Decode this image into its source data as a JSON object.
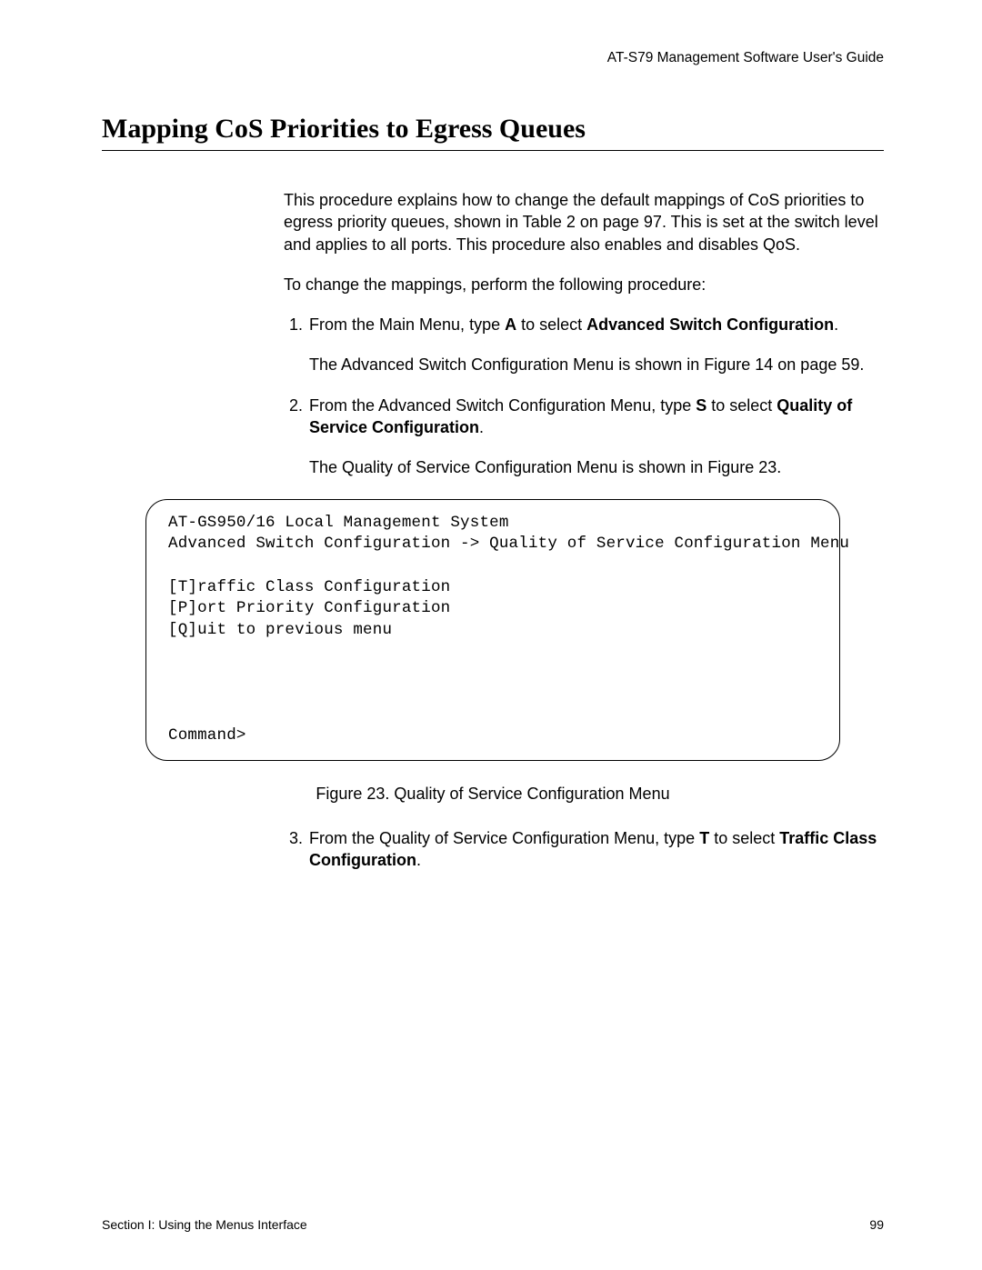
{
  "header": {
    "running": "AT-S79 Management Software User's Guide"
  },
  "title": "Mapping CoS Priorities to Egress Queues",
  "intro": {
    "p1": "This procedure explains how to change the default mappings of CoS priorities to egress priority queues, shown in Table 2 on page 97. This is set at the switch level and applies to all ports. This procedure also enables and disables QoS.",
    "p2": "To change the mappings, perform the following procedure:"
  },
  "steps": {
    "s1": {
      "line1_a": "From the Main Menu, type ",
      "line1_b": "A",
      "line1_c": " to select ",
      "line1_d": "Advanced Switch Configuration",
      "line1_e": ".",
      "line2": "The Advanced Switch Configuration Menu is shown in Figure 14 on page 59."
    },
    "s2": {
      "line1_a": "From the Advanced Switch Configuration Menu, type ",
      "line1_b": "S",
      "line1_c": " to select ",
      "line1_d": "Quality of Service Configuration",
      "line1_e": ".",
      "line2": "The Quality of Service Configuration Menu is shown in Figure 23."
    },
    "s3": {
      "line1_a": "From the Quality of Service Configuration Menu, type ",
      "line1_b": "T",
      "line1_c": " to select ",
      "line1_d": "Traffic Class Configuration",
      "line1_e": "."
    }
  },
  "terminal": {
    "l1": "AT-GS950/16 Local Management System",
    "l2": "Advanced Switch Configuration -> Quality of Service Configuration Menu",
    "blank": "",
    "l3": "[T]raffic Class Configuration",
    "l4": "[P]ort Priority Configuration",
    "l5": "[Q]uit to previous menu",
    "prompt": "Command>"
  },
  "figure_caption": "Figure 23. Quality of Service Configuration Menu",
  "footer": {
    "left": "Section I: Using the Menus Interface",
    "right": "99"
  }
}
